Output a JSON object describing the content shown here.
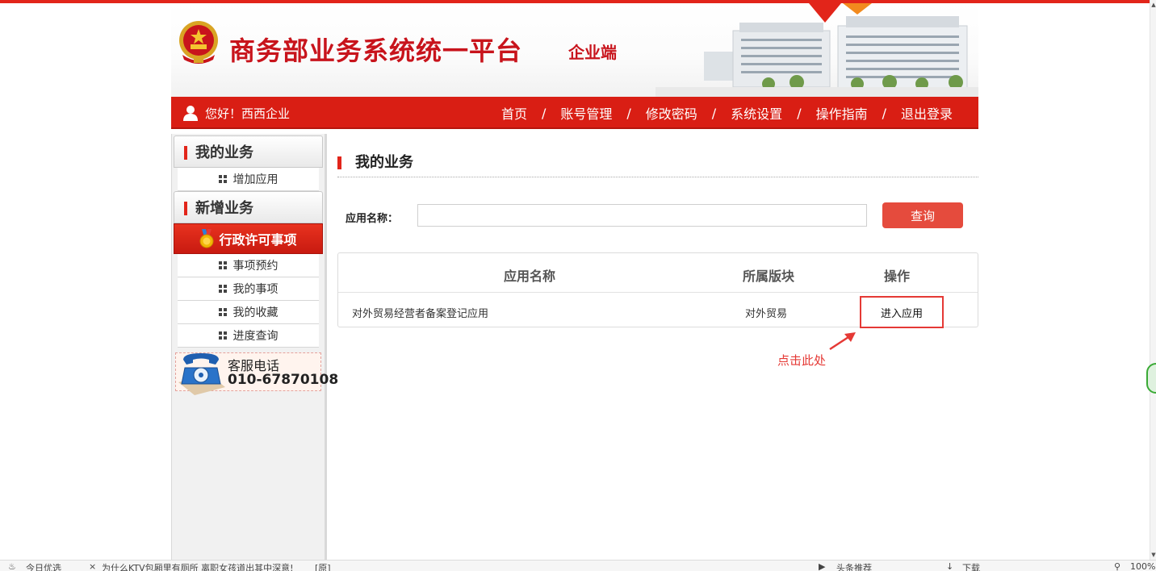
{
  "header": {
    "title": "商务部业务系统统一平台",
    "subtitle": "企业端"
  },
  "navbar": {
    "greeting": "您好！西西企业",
    "separator": "/",
    "links": [
      {
        "label": "首页"
      },
      {
        "label": "账号管理"
      },
      {
        "label": "修改密码"
      },
      {
        "label": "系统设置"
      },
      {
        "label": "操作指南"
      },
      {
        "label": "退出登录"
      }
    ]
  },
  "sidebar": {
    "section1": "我的业务",
    "section1_items": [
      "增加应用"
    ],
    "section2": "新增业务",
    "active_item": "行政许可事项",
    "section2_items": [
      "事项预约",
      "我的事项",
      "我的收藏",
      "进度查询"
    ],
    "phone_label": "客服电话",
    "phone_number": "010-67870108"
  },
  "main": {
    "title": "我的业务",
    "search_label": "应用名称：",
    "search_value": "",
    "search_button": "查询",
    "table": {
      "headers": [
        "应用名称",
        "所属版块",
        "操作"
      ],
      "rows": [
        {
          "name": "对外贸易经营者备案登记应用",
          "section": "对外贸易",
          "action": "进入应用"
        }
      ]
    }
  },
  "annotation": {
    "text": "点击此处",
    "color": "#e53935"
  },
  "statusbar": {
    "left1": "今日优选",
    "left2": "为什么KTV包厢里有厕所 离职女孩道出其中深意!",
    "left3": "[原]",
    "right1": "头条推荐",
    "right2": "下载",
    "zoom": "100%"
  },
  "colors": {
    "brand_red": "#d91e14",
    "title_red": "#c8141c",
    "button_red": "#e54b3d"
  }
}
